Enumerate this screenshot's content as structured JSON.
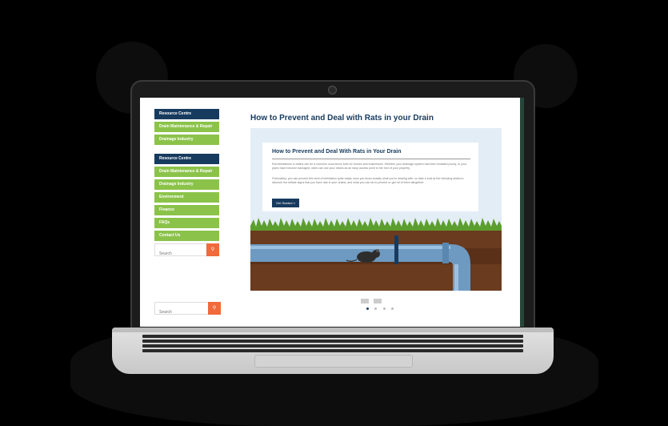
{
  "sidebar": {
    "group1": [
      {
        "label": "Resource Centre",
        "active": true
      },
      {
        "label": "Drain Maintenance & Repair",
        "active": false
      },
      {
        "label": "Drainage Industry",
        "active": false
      }
    ],
    "group2": [
      {
        "label": "Resource Centre",
        "active": true
      },
      {
        "label": "Drain Maintenance & Repair",
        "active": false
      },
      {
        "label": "Drainage Industry",
        "active": false
      },
      {
        "label": "Environment",
        "active": false
      },
      {
        "label": "Finance",
        "active": false
      },
      {
        "label": "FAQs",
        "active": false
      },
      {
        "label": "Contact Us",
        "active": false
      }
    ],
    "search_placeholder": "Search",
    "bottom_search_placeholder": "Search"
  },
  "main": {
    "title": "How to Prevent and Deal with Rats in your Drain",
    "slide": {
      "title": "How to Prevent and Deal With Rats in Your Drain",
      "paragraph1": "Rat infestations in drains can be a common occurrence both for homes and businesses. Whether your drainage system has been installed poorly, or your pipes have become damaged, rates can use your drains as an easy access point to the rest of your property.",
      "paragraph2": "Fortunately, you can prevent this kind of infestation quite easily once you know exactly what you're dealing with, so take a look at the following slides to discover the telltale signs that you have rats in your drains, and what you can do to prevent or get rid of them altogether.",
      "button_label": "Get Started »"
    },
    "pager": {
      "dots": 4,
      "active_index": 0
    }
  },
  "colors": {
    "navy": "#173b5e",
    "green": "#8bc34a",
    "orange": "#f06a3b",
    "slide_bg": "#e3edf6",
    "soil": "#6a3b1e",
    "pipe": "#6e9ac2"
  },
  "icons": {
    "search": "search-icon",
    "rat": "rat-illustration",
    "camera": "webcam-icon"
  }
}
